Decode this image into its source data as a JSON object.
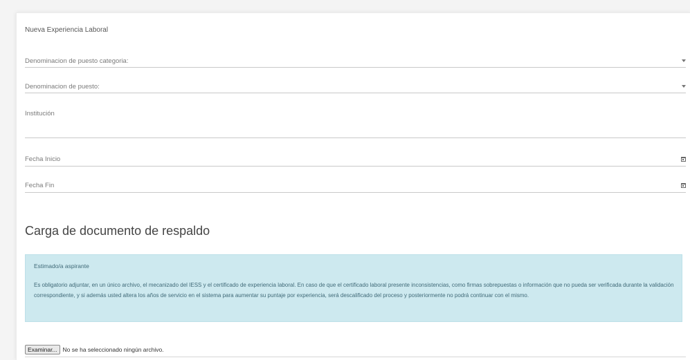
{
  "form": {
    "title": "Nueva Experiencia Laboral",
    "fields": [
      {
        "label": "Denominacion de puesto categoria:",
        "icon": "caret-down-icon"
      },
      {
        "label": "Denominacion de puesto:",
        "icon": "caret-down-icon"
      },
      {
        "label": "Institución"
      },
      {
        "label": "Fecha Inicio",
        "icon": "calendar-icon"
      },
      {
        "label": "Fecha Fin",
        "icon": "calendar-icon"
      }
    ]
  },
  "upload": {
    "section_title": "Carga de documento de respaldo",
    "alert_heading": "Estimado/a aspirante",
    "alert_body": "Es obligatorio adjuntar, en un único archivo, el mecanizado del IESS y el certificado de experiencia laboral. En caso de que el certificado laboral presente inconsistencias, como firmas sobrepuestas o información que no pueda ser verificada durante la validación correspondiente, y si además usted altera los años de servicio en el sistema para aumentar su puntaje por experiencia, será descalificado del proceso y posteriormente no podrá continuar con el mismo.",
    "browse_label": "Examinar...",
    "file_status": "No se ha seleccionado ningún archivo."
  },
  "colors": {
    "alert_bg": "#cde9ef",
    "alert_text": "#406a78"
  }
}
